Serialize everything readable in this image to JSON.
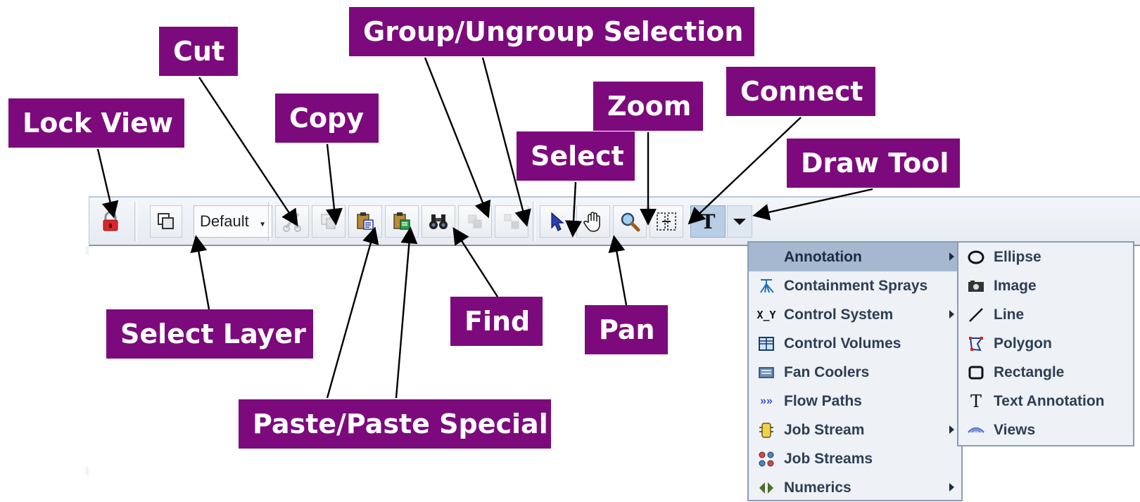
{
  "callouts": {
    "lock_view": "Lock View",
    "cut": "Cut",
    "copy": "Copy",
    "group_ungroup": "Group/Ungroup Selection",
    "select": "Select",
    "zoom": "Zoom",
    "connect": "Connect",
    "draw_tool": "Draw Tool",
    "select_layer": "Select Layer",
    "find": "Find",
    "pan": "Pan",
    "paste": "Paste/Paste Special"
  },
  "toolbar": {
    "layer_value": "Default",
    "text_tool_glyph": "T",
    "icons": [
      "lock-icon",
      "layers-icon",
      "scissors-icon",
      "copy-icon",
      "paste-icon",
      "paste-special-icon",
      "binoculars-icon",
      "group-icon",
      "ungroup-icon",
      "select-arrow-icon",
      "hand-icon",
      "magnifier-icon",
      "connect-icon",
      "text-tool-icon",
      "dropdown-arrow-icon"
    ]
  },
  "draw_menu": {
    "items": [
      {
        "label": "Annotation",
        "icon": "none",
        "submenu": true,
        "selected": true
      },
      {
        "label": "Containment Sprays",
        "icon": "spray-icon",
        "submenu": false
      },
      {
        "label": "Control System",
        "icon": "control-system-icon",
        "submenu": true
      },
      {
        "label": "Control Volumes",
        "icon": "grid-icon",
        "submenu": false
      },
      {
        "label": "Fan Coolers",
        "icon": "fan-cooler-icon",
        "submenu": false
      },
      {
        "label": "Flow Paths",
        "icon": "flow-paths-icon",
        "submenu": false
      },
      {
        "label": "Job Stream",
        "icon": "job-stream-icon",
        "submenu": true
      },
      {
        "label": "Job Streams",
        "icon": "job-streams-icon",
        "submenu": false
      },
      {
        "label": "Numerics",
        "icon": "numerics-icon",
        "submenu": true
      }
    ]
  },
  "annotation_menu": {
    "items": [
      {
        "label": "Ellipse",
        "icon": "ellipse-icon"
      },
      {
        "label": "Image",
        "icon": "image-icon"
      },
      {
        "label": "Line",
        "icon": "line-icon"
      },
      {
        "label": "Polygon",
        "icon": "polygon-icon"
      },
      {
        "label": "Rectangle",
        "icon": "rectangle-icon"
      },
      {
        "label": "Text Annotation",
        "icon": "text-icon"
      },
      {
        "label": "Views",
        "icon": "views-icon"
      }
    ]
  },
  "colors": {
    "callout_bg": "#7d0a7d",
    "callout_text": "#ffffff",
    "menu_bg": "#eef1f5",
    "menu_selected": "#a5b8cf"
  }
}
